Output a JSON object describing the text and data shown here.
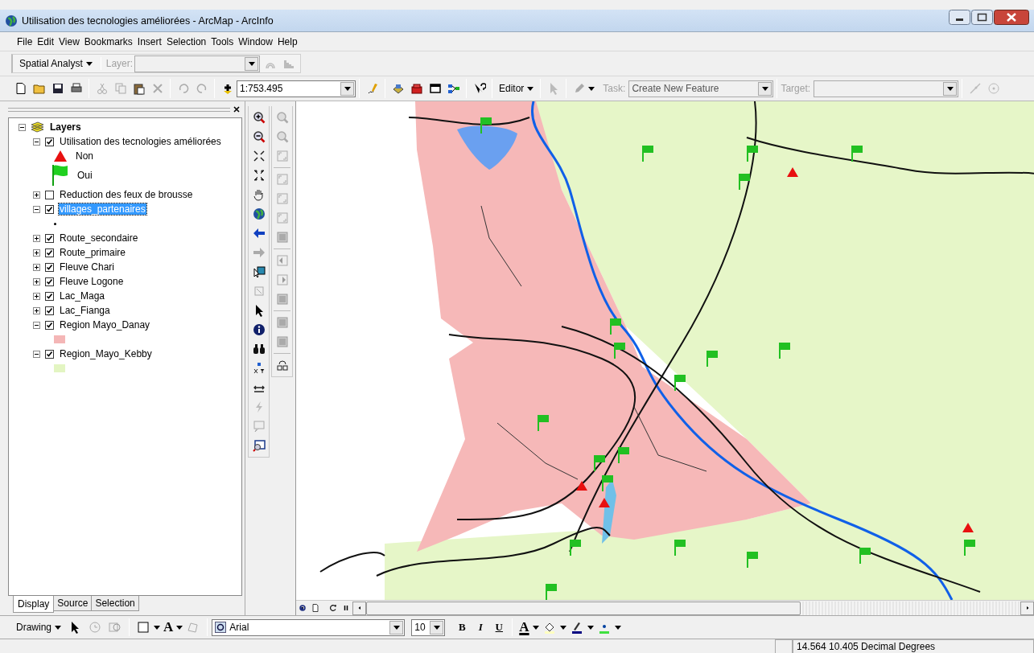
{
  "window": {
    "title": "Utilisation des tecnologies améliorées - ArcMap - ArcInfo"
  },
  "menu": [
    {
      "label": "File"
    },
    {
      "label": "Edit"
    },
    {
      "label": "View"
    },
    {
      "label": "Bookmarks"
    },
    {
      "label": "Insert"
    },
    {
      "label": "Selection"
    },
    {
      "label": "Tools"
    },
    {
      "label": "Window"
    },
    {
      "label": "Help"
    }
  ],
  "spatial_toolbar": {
    "menu": "Spatial Analyst",
    "layer_label": "Layer:",
    "layer_disabled": true
  },
  "standard_toolbar": {
    "scale": "1:753.495"
  },
  "editor_toolbar": {
    "menu": "Editor",
    "task_label": "Task:",
    "task": "Create New Feature",
    "target_label": "Target:",
    "disabled": true
  },
  "toc": {
    "root": {
      "label": "Layers",
      "expanded": true,
      "selected": false,
      "children": [
        {
          "label": "Utilisation des tecnologies améliorées",
          "checked": true,
          "expanded": true,
          "selected": false,
          "legend": [
            {
              "kind": "triangle",
              "label": "Non"
            },
            {
              "kind": "flag",
              "label": "Oui"
            }
          ]
        },
        {
          "label": "Reduction des feux de brousse",
          "checked": false,
          "expanded": false,
          "selected": false
        },
        {
          "label": "villages_partenaires",
          "checked": true,
          "expanded": true,
          "selected": true,
          "legend": [
            {
              "kind": "dot"
            }
          ]
        },
        {
          "label": "Route_secondaire",
          "checked": true,
          "expanded": false,
          "selected": false
        },
        {
          "label": "Route_primaire",
          "checked": true,
          "expanded": false,
          "selected": false
        },
        {
          "label": "Fleuve Chari",
          "checked": true,
          "expanded": false,
          "selected": false
        },
        {
          "label": "Fleuve Logone",
          "checked": true,
          "expanded": false,
          "selected": false
        },
        {
          "label": "Lac_Maga",
          "checked": true,
          "expanded": false,
          "selected": false
        },
        {
          "label": "Lac_Fianga",
          "checked": true,
          "expanded": false,
          "selected": false
        },
        {
          "label": "Region Mayo_Danay",
          "checked": true,
          "expanded": true,
          "selected": false,
          "legend": [
            {
              "kind": "swatch",
              "color": "#f4b6b6"
            }
          ]
        },
        {
          "label": "Region_Mayo_Kebby",
          "checked": true,
          "expanded": true,
          "selected": false,
          "legend": [
            {
              "kind": "swatch",
              "color": "#e3f5c2"
            }
          ]
        }
      ]
    }
  },
  "toc_tabs": [
    {
      "label": "Display",
      "selected": true
    },
    {
      "label": "Source",
      "selected": false
    },
    {
      "label": "Selection",
      "selected": false
    }
  ],
  "drawing_toolbar": {
    "menu": "Drawing",
    "text_tool": "A",
    "font": "Arial",
    "size": "10",
    "styles": [
      {
        "label": "B",
        "kind": "bold"
      },
      {
        "label": "I",
        "kind": "italic"
      },
      {
        "label": "U",
        "kind": "underline"
      }
    ],
    "font_color": "A"
  },
  "status_bar": {
    "coordinates": "14.564  10.405 Decimal Degrees"
  }
}
